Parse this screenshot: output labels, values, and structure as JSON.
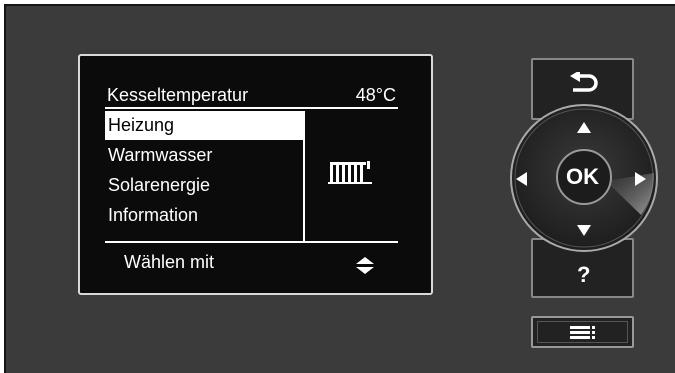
{
  "display": {
    "header_title": "Kesseltemperatur",
    "header_value": "48°C",
    "menu_items": [
      "Heizung",
      "Warmwasser",
      "Solarenergie",
      "Information"
    ],
    "selected_index": 0,
    "footer_text": "Wählen mit"
  },
  "controls": {
    "ok_label": "OK",
    "help_label": "?"
  },
  "icons": {
    "back": "back-arrow-icon",
    "up": "arrow-up-icon",
    "down": "arrow-down-icon",
    "left": "arrow-left-icon",
    "right": "arrow-right-icon",
    "menu": "menu-lines-icon",
    "radiator": "radiator-icon",
    "updown": "up-down-arrows-icon"
  },
  "colors": {
    "panel": "#3b3b3b",
    "screen": "#0b0b0b",
    "screen_border": "#d9d9d9",
    "button": "#222222"
  }
}
